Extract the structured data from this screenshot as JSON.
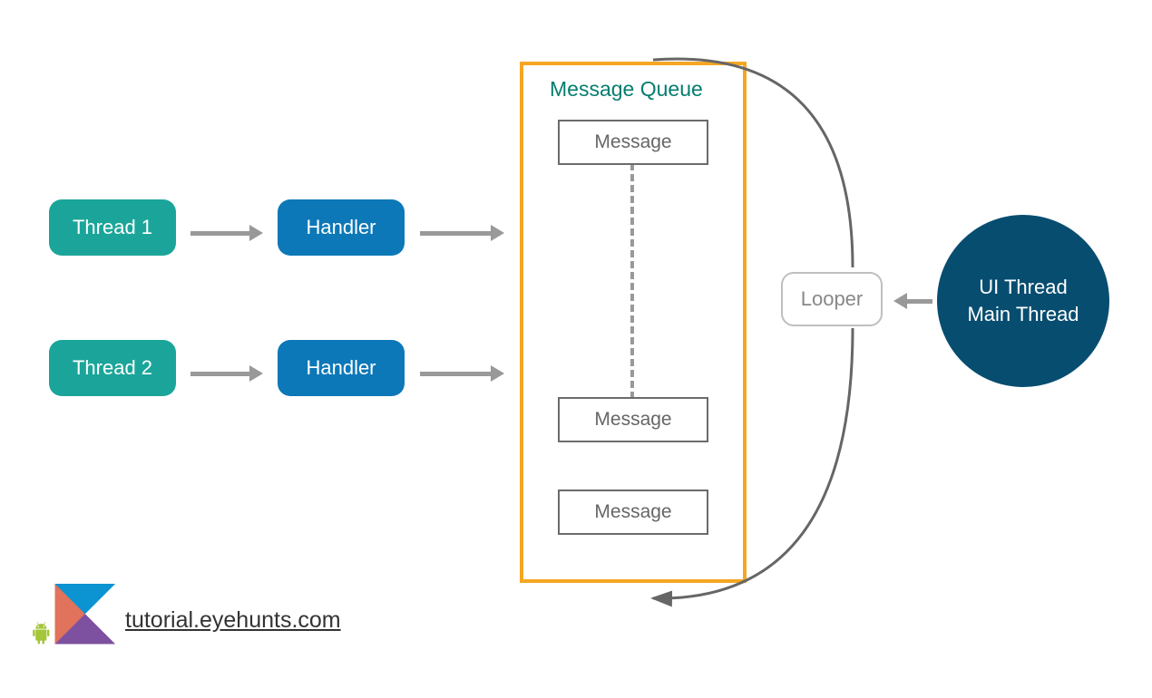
{
  "threads": [
    {
      "label": "Thread 1"
    },
    {
      "label": "Thread 2"
    }
  ],
  "handlers": [
    {
      "label": "Handler"
    },
    {
      "label": "Handler"
    }
  ],
  "queue": {
    "title": "Message Queue",
    "messages": [
      {
        "label": "Message"
      },
      {
        "label": "Message"
      },
      {
        "label": "Message"
      }
    ]
  },
  "looper": {
    "label": "Looper"
  },
  "uiThread": {
    "line1": "UI Thread",
    "line2": "Main Thread"
  },
  "footer": "tutorial.eyehunts.com",
  "colors": {
    "teal": "#1BA59A",
    "blue": "#0C78B8",
    "orange": "#F5A623",
    "darkBlue": "#074D70",
    "grey": "#999"
  }
}
